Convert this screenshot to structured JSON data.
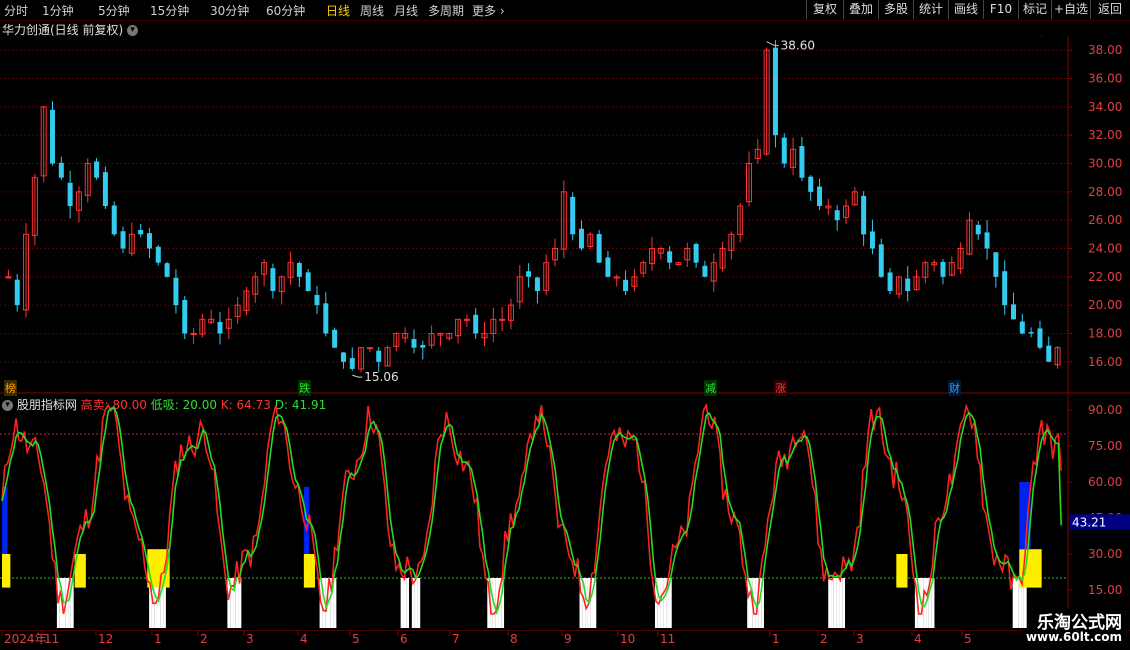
{
  "toolbar": {
    "tabs": [
      "分时",
      "1分钟",
      "5分钟",
      "15分钟",
      "30分钟",
      "60分钟",
      "日线",
      "周线",
      "月线",
      "多周期",
      "更多"
    ],
    "active_tab": "日线",
    "right_buttons": [
      "复权",
      "叠加",
      "多股",
      "统计",
      "画线",
      "F10",
      "标记",
      "+自选",
      "返回"
    ]
  },
  "main": {
    "stock_title": "华力创通(日线 前复权)",
    "high_label": "38.60",
    "low_label": "15.06",
    "y_ticks": [
      "38.00",
      "36.00",
      "34.00",
      "32.00",
      "30.00",
      "28.00",
      "26.00",
      "24.00",
      "22.00",
      "20.00",
      "18.00",
      "16.00"
    ],
    "markers": [
      {
        "text": "榜",
        "color": "#ffa000"
      },
      {
        "text": "跌",
        "color": "#33dd33"
      },
      {
        "text": "减",
        "color": "#33dd33"
      },
      {
        "text": "涨",
        "color": "#ff3333"
      },
      {
        "text": "财",
        "color": "#3399ff"
      }
    ]
  },
  "indicator": {
    "name": "股朋指标网",
    "high_sell_label": "高卖:",
    "high_sell_value": "80.00",
    "low_buy_label": "低吸:",
    "low_buy_value": "20.00",
    "k_label": "K:",
    "k_value": "64.73",
    "d_label": "D:",
    "d_value": "41.91",
    "current_tag": "43.21",
    "y_ticks": [
      "90.00",
      "75.00",
      "60.00",
      "45.00",
      "30.00",
      "15.00"
    ]
  },
  "x_axis": [
    "2024年",
    "11",
    "12",
    "1",
    "2",
    "3",
    "4",
    "5",
    "6",
    "7",
    "8",
    "9",
    "10",
    "11",
    "1",
    "2",
    "3",
    "4",
    "5"
  ],
  "watermark": {
    "line1": "乐淘公式网",
    "line2": "www.60lt.com"
  },
  "colors": {
    "up": "#ff3333",
    "down": "#33ccee",
    "k_line": "#ff2222",
    "d_line": "#22dd22",
    "grid": "#5a0000"
  },
  "chart_data": [
    {
      "type": "candlestick",
      "title": "华力创通(日线 前复权)",
      "ylim": [
        15,
        39
      ],
      "close_path": [
        22,
        20,
        25,
        29,
        34,
        30,
        29,
        27,
        28,
        30,
        29,
        27,
        25,
        24,
        25,
        25,
        24,
        23,
        22,
        20,
        18,
        18,
        19,
        19,
        18,
        19,
        20,
        21,
        22,
        23,
        21,
        22,
        23,
        22,
        21,
        20,
        18,
        17,
        16,
        15.5,
        17,
        17,
        16,
        17,
        18,
        18,
        17,
        17,
        18,
        18,
        18,
        19,
        19,
        18,
        18,
        19,
        19,
        20,
        22,
        22,
        21,
        23,
        24,
        28,
        25,
        24,
        25,
        23,
        22,
        22,
        21,
        22,
        23,
        24,
        24,
        23,
        23,
        24,
        23,
        22,
        23,
        24,
        25,
        27,
        30,
        31,
        38,
        32,
        30,
        31,
        29,
        28,
        27,
        27,
        26,
        27,
        28,
        25,
        24,
        22,
        21,
        22,
        21,
        22,
        23,
        23,
        22,
        23,
        24,
        26,
        25,
        24,
        22,
        20,
        19,
        18,
        18,
        17,
        16,
        17
      ],
      "high_annotation": 38.6,
      "low_annotation": 15.06
    },
    {
      "type": "line",
      "title": "股朋指标网",
      "ylim": [
        0,
        95
      ],
      "reference_lines": {
        "high_sell": 80.0,
        "low_buy": 20.0
      },
      "k_last": 64.73,
      "d_last": 41.91,
      "current_value": 43.21
    }
  ]
}
